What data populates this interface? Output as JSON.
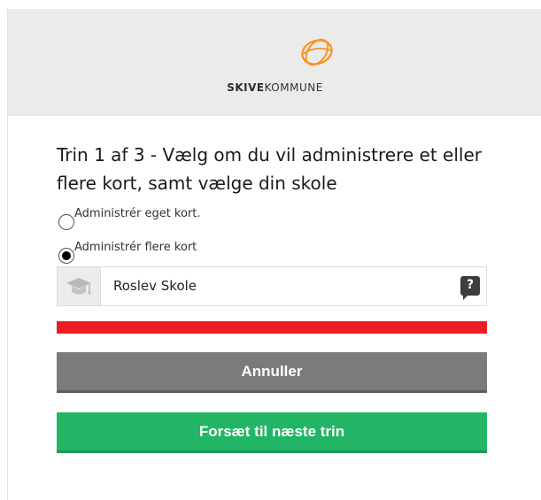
{
  "header": {
    "brand_bold": "SKIVE",
    "brand_light": "KOMMUNE",
    "logo_color": "#f7941d"
  },
  "main": {
    "title": "Trin 1 af 3 - Vælg om du vil administrere et eller flere kort, samt vælge din skole",
    "options": [
      {
        "label": "Administrér eget kort.",
        "checked": false
      },
      {
        "label": "Administrér flere kort",
        "checked": true
      }
    ],
    "school": {
      "value": "Roslev Skole",
      "icon": "graduation-cap-icon",
      "help_label": "?"
    },
    "error_color": "#ec1c24",
    "cancel_label": "Annuller",
    "next_label": "Forsæt til næste trin",
    "colors": {
      "cancel": "#7b7b7b",
      "next": "#22b566"
    }
  }
}
